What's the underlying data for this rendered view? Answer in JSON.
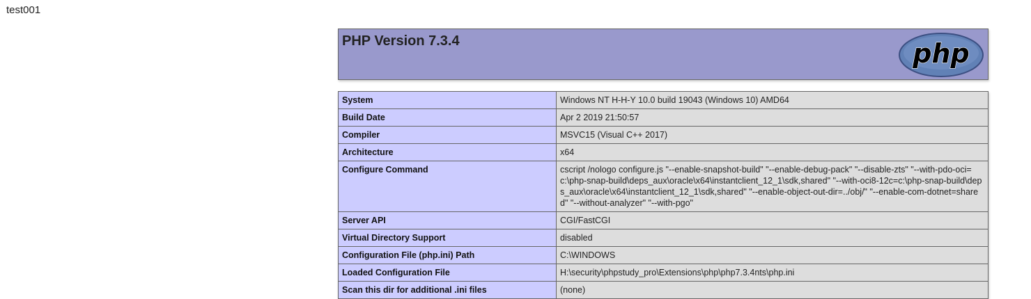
{
  "page": {
    "top_text": "test001"
  },
  "header": {
    "title": "PHP Version 7.3.4",
    "logo_text": "php",
    "colors": {
      "header_bg": "#9999cc",
      "label_bg": "#ccccff",
      "value_bg": "#dddddd",
      "logo_fill": "#6181b6"
    }
  },
  "rows": [
    {
      "label": "System",
      "value": "Windows NT H-H-Y 10.0 build 19043 (Windows 10) AMD64"
    },
    {
      "label": "Build Date",
      "value": "Apr 2 2019 21:50:57"
    },
    {
      "label": "Compiler",
      "value": "MSVC15 (Visual C++ 2017)"
    },
    {
      "label": "Architecture",
      "value": "x64"
    },
    {
      "label": "Configure Command",
      "value": "cscript /nologo configure.js \"--enable-snapshot-build\" \"--enable-debug-pack\" \"--disable-zts\" \"--with-pdo-oci=c:\\php-snap-build\\deps_aux\\oracle\\x64\\instantclient_12_1\\sdk,shared\" \"--with-oci8-12c=c:\\php-snap-build\\deps_aux\\oracle\\x64\\instantclient_12_1\\sdk,shared\" \"--enable-object-out-dir=../obj/\" \"--enable-com-dotnet=shared\" \"--without-analyzer\" \"--with-pgo\""
    },
    {
      "label": "Server API",
      "value": "CGI/FastCGI"
    },
    {
      "label": "Virtual Directory Support",
      "value": "disabled"
    },
    {
      "label": "Configuration File (php.ini) Path",
      "value": "C:\\WINDOWS"
    },
    {
      "label": "Loaded Configuration File",
      "value": "H:\\security\\phpstudy_pro\\Extensions\\php\\php7.3.4nts\\php.ini"
    },
    {
      "label": "Scan this dir for additional .ini files",
      "value": "(none)"
    }
  ]
}
